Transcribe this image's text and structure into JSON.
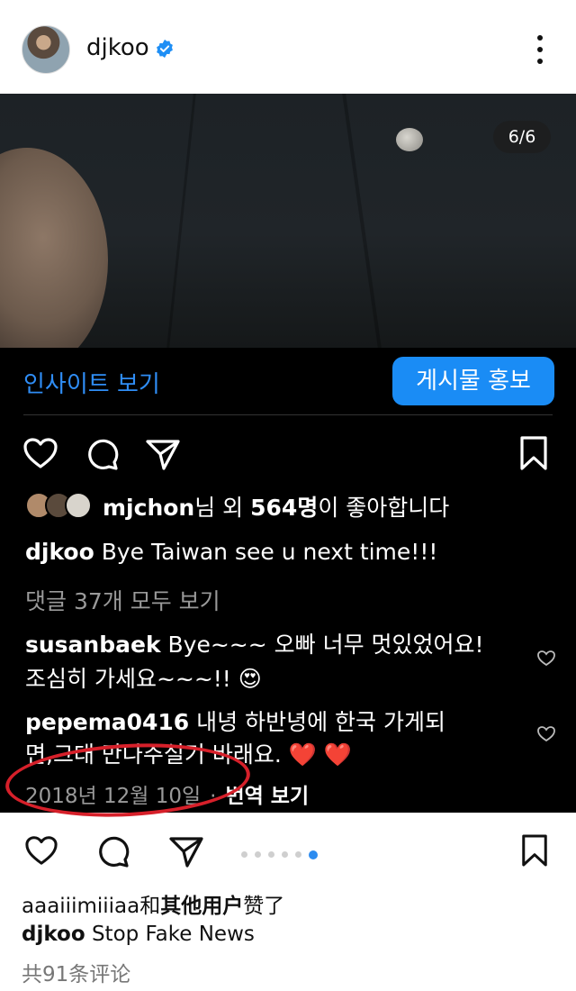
{
  "header": {
    "username": "djkoo",
    "verified_icon": "verified-badge-icon",
    "more_icon": "more-vertical-icon"
  },
  "post": {
    "image_counter": "6/6",
    "insights_link": "인사이트 보기",
    "promote_button": "게시물 홍보",
    "likes": {
      "user": "mjchon",
      "text_mid": "님 외 ",
      "count": "564명",
      "text_end": "이 좋아합니다"
    },
    "caption": {
      "user": "djkoo",
      "text": " Bye Taiwan see u next time!!!"
    },
    "view_comments": "댓글 37개 모두 보기",
    "comments": [
      {
        "user": "susanbaek",
        "text_line1": " Bye~~~ 오빠 너무 멋있었어요!",
        "text_line2": "조심히 가세요~~~!! 😍"
      },
      {
        "user": "pepema0416",
        "text_line1": " 내녕 하반녕에 한국 가게되",
        "text_line2": "면,그대 만나주실기 바래요. ❤️ ❤️"
      }
    ],
    "date": "2018년 12월 10일",
    "separator": "·",
    "translate": "번역 보기"
  },
  "lower": {
    "likes_user": "aaaiiimiiiaa",
    "likes_mid": "和",
    "likes_bold": "其他用户",
    "likes_end": "赞了",
    "caption_user": "djkoo",
    "caption_text": " Stop Fake News",
    "comments": "共91条评论"
  },
  "colors": {
    "accent_blue": "#1a8cf5",
    "link_blue": "#2f8df5",
    "annotation_red": "#d6202a"
  }
}
